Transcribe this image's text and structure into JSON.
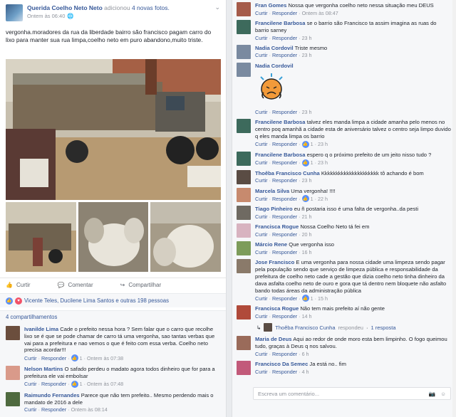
{
  "post": {
    "author": "Querida Coelho Neto Neto",
    "verb": "adicionou",
    "photos_link": "4 novas fotos.",
    "time": "Ontem às 06:40",
    "text": "vergonha.moradores da rua da liberdade bairro são francisco pagam carro do lixo para manter sua rua limpa,coelho neto em puro abandono,muito triste.",
    "actions": {
      "like": "Curtir",
      "comment": "Comentar",
      "share": "Compartilhar"
    },
    "likes_text": "Vicente Teles, Ducilene Lima Santos e outras 198 pessoas",
    "shares_text": "4 compartilhamentos"
  },
  "left_comments": [
    {
      "name": "Ivanilde Lima",
      "text": "Cade o prefeito nessa hora ? Sem falar que o carro que recolhe lixo se é que se pode chamar de carro tá uma vergonha, sao tantas verbas que vai para a prefeitura e nao vemos o que é feito com essa verba. Coelho neto precisa acordar!!!",
      "like": "Curtir",
      "reply": "Responder",
      "count": "1",
      "time": "Ontem às 07:38"
    },
    {
      "name": "Nelson Martins",
      "text": "O safado perdeu o madato agora todos dinheiro que for para a prefeitura ele vai embolsar",
      "like": "Curtir",
      "reply": "Responder",
      "count": "1",
      "time": "Ontem às 07:48"
    },
    {
      "name": "Raimundo Fernandes",
      "text": "Parece que não tem prefeito.. Mesmo perdendo mais o mandato de 2016 a dele",
      "like": "Curtir",
      "reply": "Responder",
      "count": "",
      "time": "Ontem às 08:14"
    }
  ],
  "right_comments": [
    {
      "name": "Fran Gomes",
      "text": "Nossa que vergonha coelho neto nessa situação meu DEUS",
      "like": "Curtir",
      "reply": "Responder",
      "count": "",
      "time": "Ontem às 08:47"
    },
    {
      "name": "Francilene Barbosa",
      "text": "se o barrio são Francisco ta assim imagina as ruas do barrio sarney",
      "like": "Curtir",
      "reply": "Responder",
      "count": "",
      "time": "23 h"
    },
    {
      "name": "Nadia Cordovil",
      "text": "Triste mesmo",
      "like": "Curtir",
      "reply": "Responder",
      "count": "",
      "time": "23 h"
    },
    {
      "name": "Nadia Cordovil",
      "text": "",
      "like": "Curtir",
      "reply": "Responder",
      "count": "",
      "time": "23 h"
    },
    {
      "name": "Francilene Barbosa",
      "text": "talvez eles manda limpa a cidade amanha pelo menos no centro poq amanhã a cidade esta de aniversário talvez o centro seja limpo duvido q eles manda limpa os barrio",
      "like": "Curtir",
      "reply": "Responder",
      "count": "1",
      "time": "23 h"
    },
    {
      "name": "Francilene Barbosa",
      "text": "espero q o próximo prefeito de um jeito nisso tudo ?",
      "like": "Curtir",
      "reply": "Responder",
      "count": "1",
      "time": "23 h"
    },
    {
      "name": "Thoêba Francisco Cunha",
      "text": "Kkkkkkkkkkkkkkkkkkkkk tô achando é bom",
      "like": "Curtir",
      "reply": "Responder",
      "count": "",
      "time": "23 h"
    },
    {
      "name": "Marcela Silva",
      "text": "Uma vergonha! !!!!",
      "like": "Curtir",
      "reply": "Responder",
      "count": "1",
      "time": "22 h"
    },
    {
      "name": "Tiago Pinheiro",
      "text": "eu ñ postaria isso é uma falta de vergonha..da pesti",
      "like": "Curtir",
      "reply": "Responder",
      "count": "",
      "time": "21 h"
    },
    {
      "name": "Francisca Rogue",
      "text": "Nossa Coelho Neto tá fei em",
      "like": "Curtir",
      "reply": "Responder",
      "count": "",
      "time": "20 h"
    },
    {
      "name": "Márcio Rene",
      "text": "Que vergonha isso",
      "like": "Curtir",
      "reply": "Responder",
      "count": "",
      "time": "16 h"
    },
    {
      "name": "Jose Francisco",
      "text": "E uma vergonha para nossa cidade uma limpeza sendo pagar pela população sendo que serviço de limpeza pública e responsabilidade da prefeitura de coelho neto cade a gestão que dizia coelho neto tinha dinheiro da dava asfalta coelho neto de ouro e gora que tá dentro nem bloquete não asfalto bando todas áreas da administração pública",
      "like": "Curtir",
      "reply": "Responder",
      "count": "1",
      "time": "15 h"
    },
    {
      "name": "Francisca Rogue",
      "text": "Não tem mais prefeito aí não gente",
      "like": "Curtir",
      "reply": "Responder",
      "count": "",
      "time": "14 h"
    },
    {
      "name": "Maria de Deus",
      "text": "Aqui ao redor de onde moro esta bem limpinho. O fogo queimou tudo, graças à Deus q nos salvou.",
      "like": "Curtir",
      "reply": "Responder",
      "count": "",
      "time": "6 h"
    },
    {
      "name": "Francisco Da Semec",
      "text": "Ja está no.. fim",
      "like": "Curtir",
      "reply": "Responder",
      "count": "",
      "time": "4 h"
    }
  ],
  "reply_summary": {
    "name": "Thoêba Francisco Cunha",
    "verb": "respondeu",
    "count": "1 resposta"
  },
  "write_placeholder": "Escreva um comentário...",
  "colors": {
    "link": "#365899",
    "bg": "#e9ebee",
    "like": "#5890ff"
  }
}
